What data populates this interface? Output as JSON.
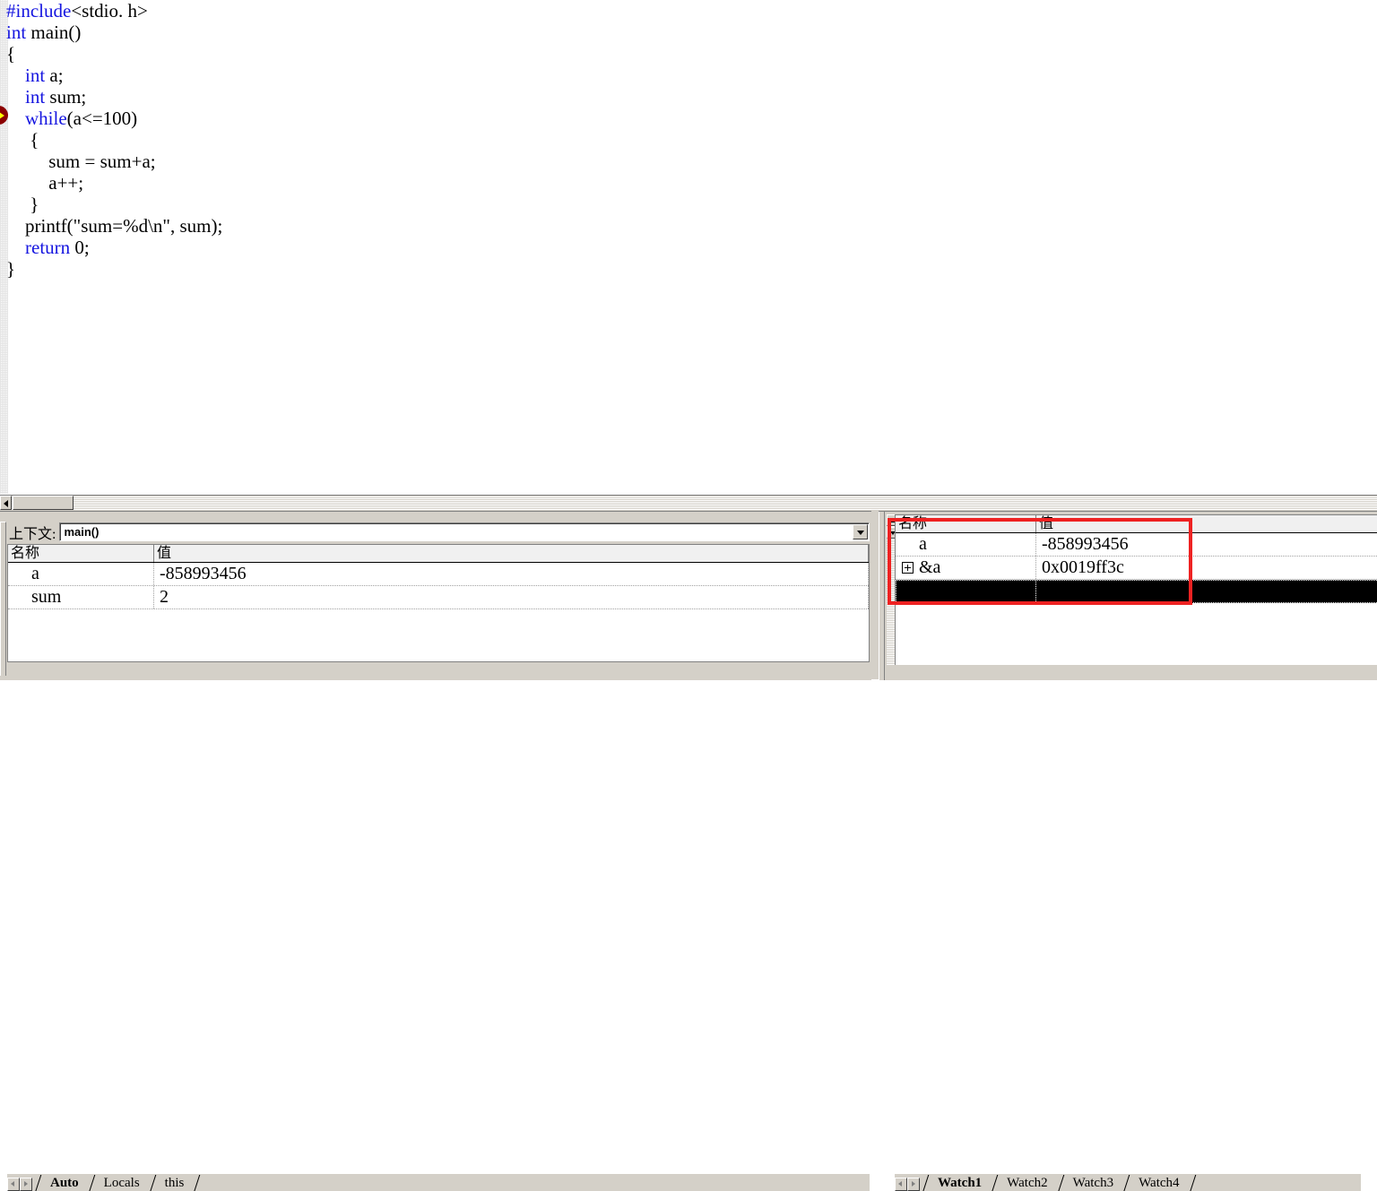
{
  "editor": {
    "language": "c",
    "breakpoint_line": 6,
    "lines": [
      [
        {
          "t": "#include",
          "c": "pre"
        },
        {
          "t": "<stdio. h>",
          "c": "plain"
        }
      ],
      [
        {
          "t": "int",
          "c": "kw"
        },
        {
          "t": " main()",
          "c": "plain"
        }
      ],
      [
        {
          "t": "{",
          "c": "plain"
        }
      ],
      [
        {
          "t": "    ",
          "c": "plain"
        },
        {
          "t": "int",
          "c": "kw"
        },
        {
          "t": " a;",
          "c": "plain"
        }
      ],
      [
        {
          "t": "    ",
          "c": "plain"
        },
        {
          "t": "int",
          "c": "kw"
        },
        {
          "t": " sum;",
          "c": "plain"
        }
      ],
      [
        {
          "t": "    ",
          "c": "plain"
        },
        {
          "t": "while",
          "c": "kw"
        },
        {
          "t": "(a<=100)",
          "c": "plain"
        }
      ],
      [
        {
          "t": "     {",
          "c": "plain"
        }
      ],
      [
        {
          "t": "         sum = sum+a;",
          "c": "plain"
        }
      ],
      [
        {
          "t": "         a++;",
          "c": "plain"
        }
      ],
      [
        {
          "t": "     }",
          "c": "plain"
        }
      ],
      [
        {
          "t": "    printf(\"sum=%d\\n\", sum);",
          "c": "plain"
        }
      ],
      [
        {
          "t": "    ",
          "c": "plain"
        },
        {
          "t": "return",
          "c": "kw"
        },
        {
          "t": " 0;",
          "c": "plain"
        }
      ],
      [
        {
          "t": "}",
          "c": "plain"
        }
      ]
    ]
  },
  "variables_panel": {
    "context_label": "上下文:",
    "context_value": "main()",
    "columns": [
      "名称",
      "值"
    ],
    "rows": [
      {
        "name": "a",
        "value": "-858993456",
        "expandable": false,
        "selected": false
      },
      {
        "name": "sum",
        "value": "2",
        "expandable": false,
        "selected": false
      }
    ],
    "tabs": [
      {
        "label": "Auto",
        "active": true
      },
      {
        "label": "Locals",
        "active": false
      },
      {
        "label": "this",
        "active": false
      }
    ]
  },
  "watch_panel": {
    "columns": [
      "名称",
      "值"
    ],
    "rows": [
      {
        "name": "a",
        "value": "-858993456",
        "expandable": false,
        "selected": false
      },
      {
        "name": "&a",
        "value": "0x0019ff3c",
        "expandable": true,
        "selected": false
      },
      {
        "name": "",
        "value": "",
        "expandable": false,
        "selected": true
      }
    ],
    "tabs": [
      {
        "label": "Watch1",
        "active": true
      },
      {
        "label": "Watch2",
        "active": false
      },
      {
        "label": "Watch3",
        "active": false
      },
      {
        "label": "Watch4",
        "active": false
      }
    ]
  },
  "annotation": {
    "shape": "rectangle",
    "color": "#ee2222"
  },
  "colors": {
    "keyword": "#1515e0",
    "text": "#000000",
    "editor_background": "#ffffff",
    "chrome": "#d4d0c8",
    "selection": "#000000",
    "annotation": "#ee2222",
    "breakpoint": "#8b0000",
    "breakpoint_arrow": "#ffff00"
  }
}
